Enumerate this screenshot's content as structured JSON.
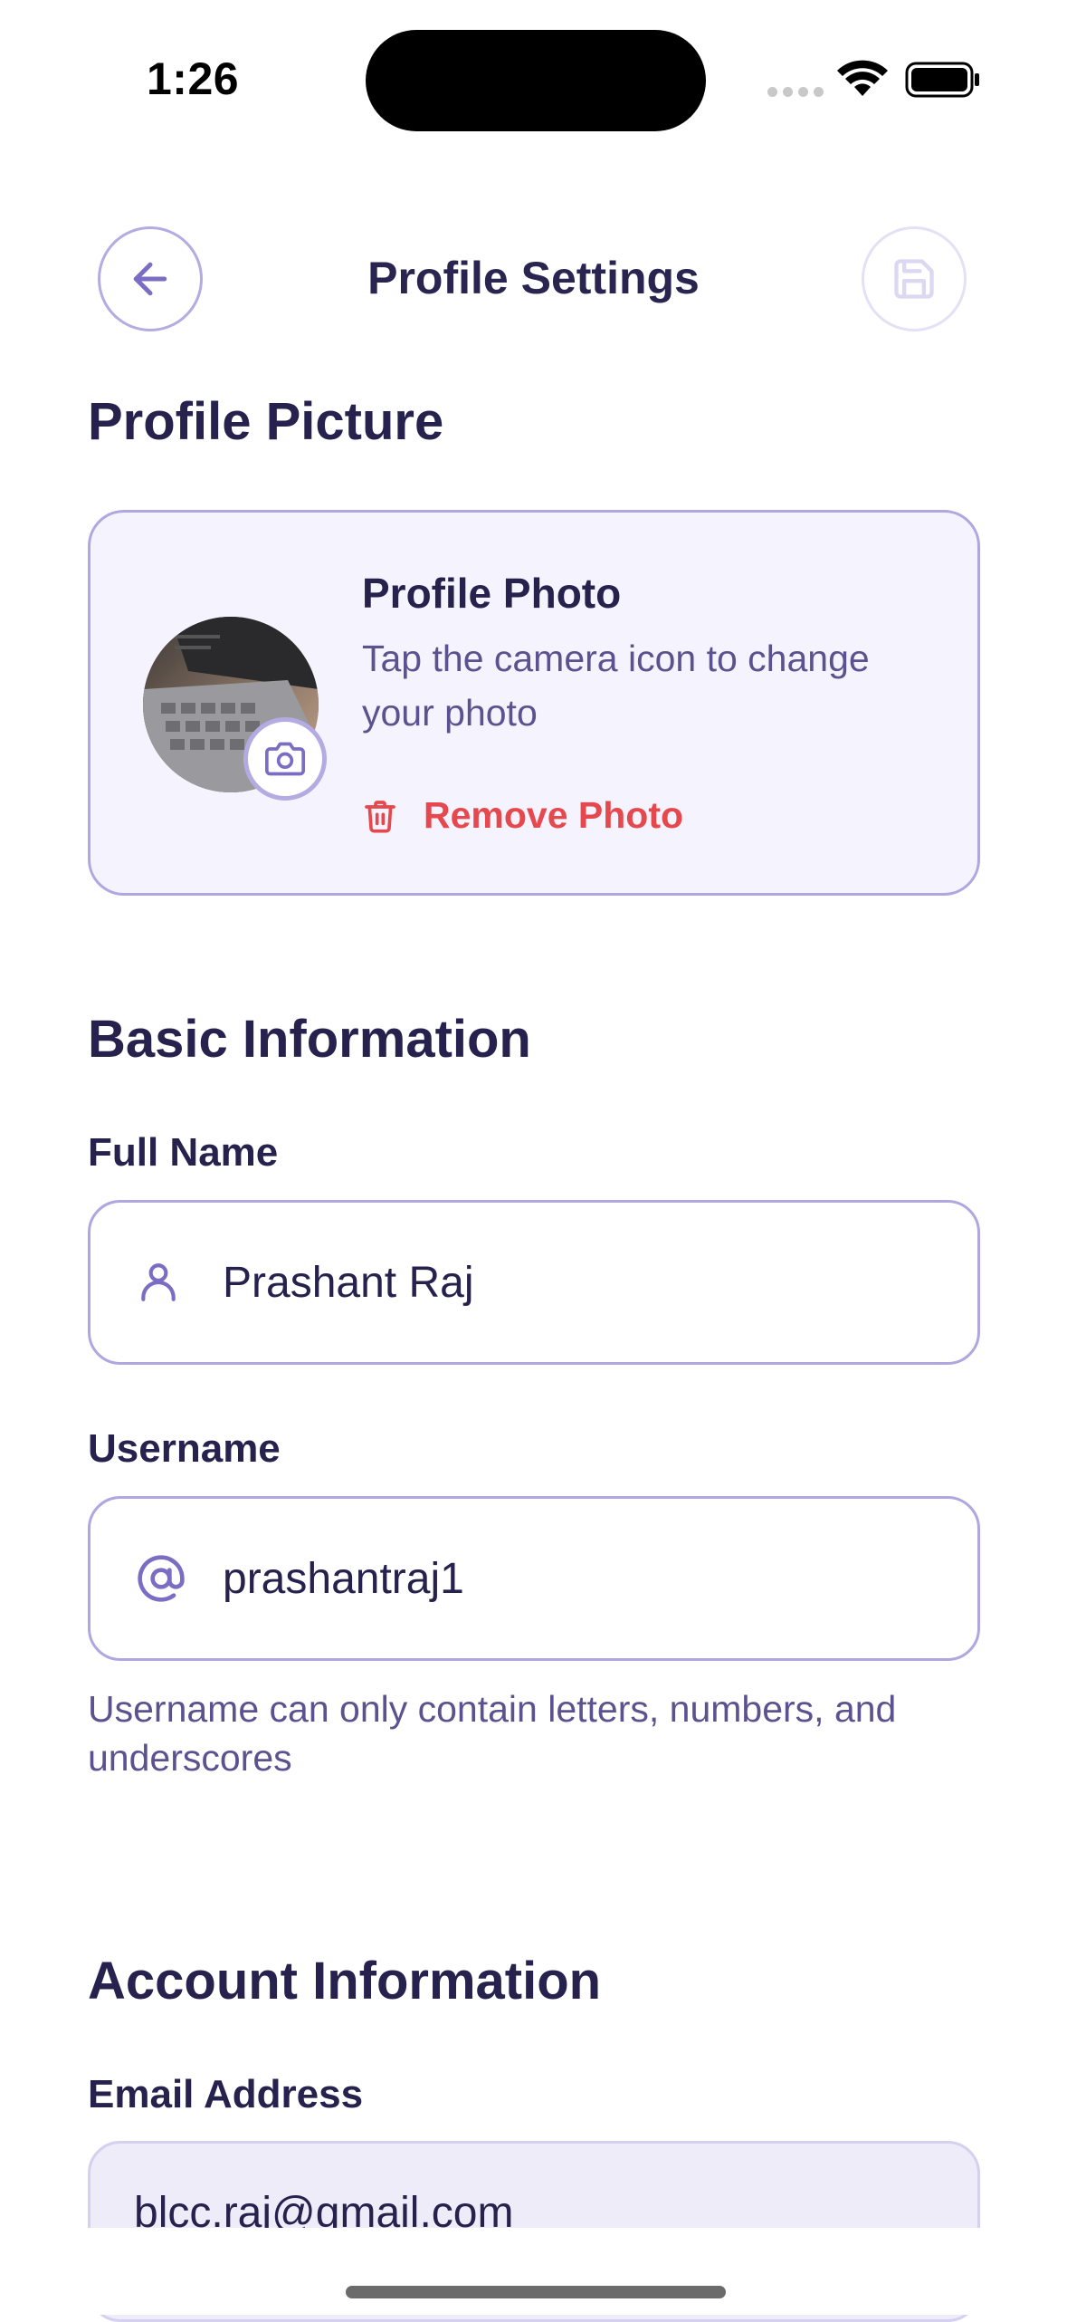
{
  "status_bar": {
    "time": "1:26"
  },
  "header": {
    "title": "Profile Settings",
    "back_icon": "arrow-left-icon",
    "save_icon": "floppy-disk-icon"
  },
  "profile_picture": {
    "section_title": "Profile Picture",
    "card_title": "Profile Photo",
    "card_desc": "Tap the camera icon to change your photo",
    "remove_label": "Remove Photo",
    "remove_color": "#e5484d"
  },
  "basic_info": {
    "section_title": "Basic Information",
    "full_name_label": "Full Name",
    "full_name_value": "Prashant Raj",
    "username_label": "Username",
    "username_value": "prashantraj1",
    "username_helper": "Username can only contain letters, numbers, and underscores"
  },
  "account_info": {
    "section_title": "Account Information",
    "email_label": "Email Address",
    "email_value": "blcc.raj@gmail.com"
  },
  "colors": {
    "accent": "#7b6cc4",
    "border": "#b0a6e0",
    "text": "#26214d",
    "muted": "#5b528f"
  }
}
